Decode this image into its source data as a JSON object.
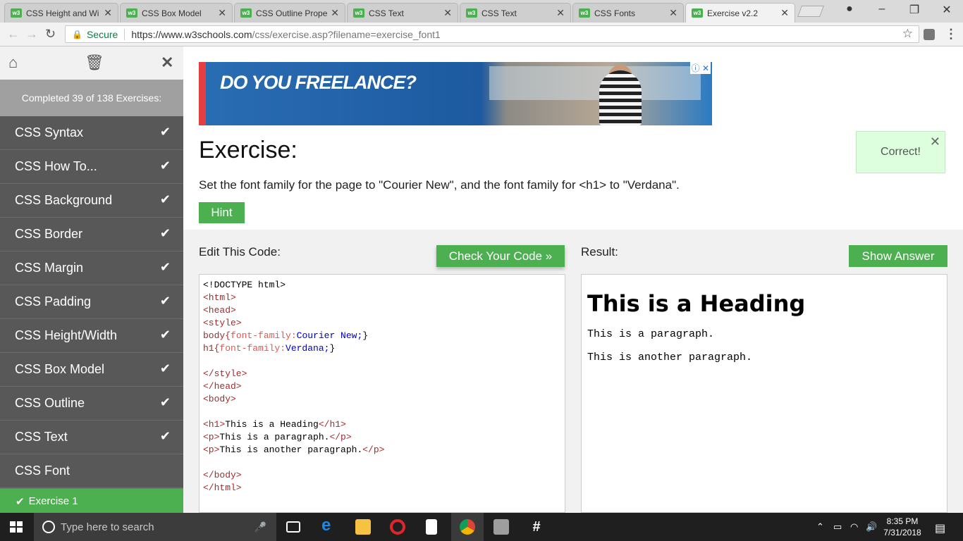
{
  "browser": {
    "tabs": [
      {
        "title": "CSS Height and Wi"
      },
      {
        "title": "CSS Box Model"
      },
      {
        "title": "CSS Outline Prope"
      },
      {
        "title": "CSS Text"
      },
      {
        "title": "CSS Text"
      },
      {
        "title": "CSS Fonts"
      },
      {
        "title": "Exercise v2.2"
      }
    ],
    "active_tab": 6,
    "secure_label": "Secure",
    "url_host": "https://www.w3schools.com",
    "url_path": "/css/exercise.asp?filename=exercise_font1"
  },
  "sidebar": {
    "completed_text": "Completed 39 of 138 Exercises:",
    "items": [
      {
        "label": "CSS Syntax",
        "done": true
      },
      {
        "label": "CSS How To...",
        "done": true
      },
      {
        "label": "CSS Background",
        "done": true
      },
      {
        "label": "CSS Border",
        "done": true
      },
      {
        "label": "CSS Margin",
        "done": true
      },
      {
        "label": "CSS Padding",
        "done": true
      },
      {
        "label": "CSS Height/Width",
        "done": true
      },
      {
        "label": "CSS Box Model",
        "done": true
      },
      {
        "label": "CSS Outline",
        "done": true
      },
      {
        "label": "CSS Text",
        "done": true
      },
      {
        "label": "CSS Font",
        "done": false
      }
    ],
    "current_exercise": "Exercise 1"
  },
  "ad": {
    "headline": "DO YOU FREELANCE?"
  },
  "exercise": {
    "title": "Exercise:",
    "description": "Set the font family for the page to \"Courier New\", and the font family for <h1> to \"Verdana\".",
    "hint_label": "Hint",
    "correct_label": "Correct!",
    "edit_label": "Edit This Code:",
    "check_label": "Check Your Code »",
    "result_label": "Result:",
    "show_answer_label": "Show Answer"
  },
  "code": {
    "l1": "<!DOCTYPE html>",
    "l2": "<html>",
    "l3": "<head>",
    "l4": "<style>",
    "l5_sel": "body{",
    "l5_prop": "font-family:",
    "l5_val": "Courier New;",
    "l5_end": "}",
    "l6_sel": "h1{",
    "l6_prop": "font-family:",
    "l6_val": "Verdana;",
    "l6_end": "}",
    "l8": "</style>",
    "l9": "</head>",
    "l10": "<body>",
    "l12_open": "<h1>",
    "l12_text": "This is a Heading",
    "l12_close": "</h1>",
    "l13_open": "<p>",
    "l13_text": "This is a paragraph.",
    "l13_close": "</p>",
    "l14_open": "<p>",
    "l14_text": "This is another paragraph.",
    "l14_close": "</p>",
    "l16": "</body>",
    "l17": "</html>"
  },
  "result": {
    "heading": "This is a Heading",
    "p1": "This is a paragraph.",
    "p2": "This is another paragraph."
  },
  "taskbar": {
    "search_placeholder": "Type here to search",
    "time": "8:35 PM",
    "date": "7/31/2018"
  },
  "colors": {
    "accent_green": "#4caf50",
    "sidebar_bg": "#585858",
    "correct_bg": "#ddffdd"
  }
}
